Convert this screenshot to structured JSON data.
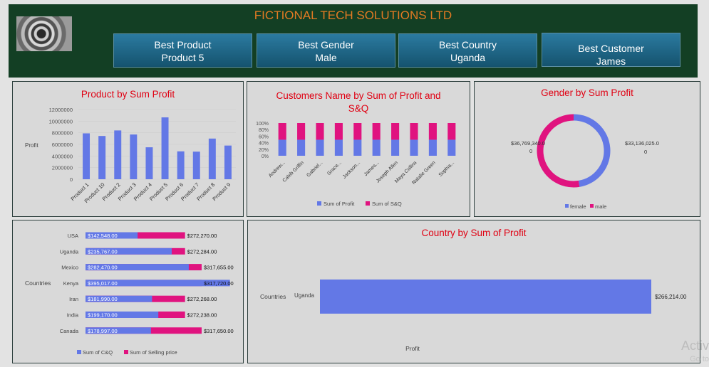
{
  "header": {
    "title": "FICTIONAL TECH SOLUTIONS LTD",
    "kpis": [
      {
        "label": "Best Product",
        "value": "Product 5"
      },
      {
        "label": "Best Gender",
        "value": "Male"
      },
      {
        "label": "Best Country",
        "value": "Uganda"
      },
      {
        "label": "Best Customer",
        "value": "James"
      }
    ]
  },
  "colors": {
    "blue": "#6378e6",
    "pink": "#e0137f",
    "title_red": "#e00012",
    "header_bg": "#133f24",
    "accent_orange": "#e27a23"
  },
  "chart_data": [
    {
      "id": "product",
      "type": "bar",
      "title": "Product by Sum Profit",
      "ylabel": "Profit",
      "ylim": [
        0,
        12000000
      ],
      "yticks": [
        "12000000",
        "10000000",
        "8000000",
        "6000000",
        "4000000",
        "2000000",
        "0"
      ],
      "categories": [
        "Product 1",
        "Product 10",
        "Product 2",
        "Product 3",
        "Product 4",
        "Product 5",
        "Product 6",
        "Product 7",
        "Product 8",
        "Product 9"
      ],
      "values": [
        7900000,
        7450000,
        8400000,
        7700000,
        5500000,
        10650000,
        4800000,
        4750000,
        7000000,
        5800000
      ]
    },
    {
      "id": "customers",
      "type": "bar",
      "stacked_percent": true,
      "title": "Customers Name by Sum of Profit and S&Q",
      "yticks": [
        "100%",
        "80%",
        "60%",
        "40%",
        "20%",
        "0%"
      ],
      "categories": [
        "Andrew...",
        "Caleb Griffin",
        "Gabriel...",
        "Grace...",
        "Jackson...",
        "James...",
        "Joseph Allen",
        "Maya Collins",
        "Natalie Green",
        "Sophia..."
      ],
      "series": [
        {
          "name": "Sum of Profit",
          "values": [
            49,
            49,
            49,
            49,
            49,
            49,
            49,
            49,
            49,
            49
          ]
        },
        {
          "name": "Sum of S&Q",
          "values": [
            51,
            51,
            51,
            51,
            51,
            51,
            51,
            51,
            51,
            51
          ]
        }
      ],
      "legend": "bottom"
    },
    {
      "id": "gender",
      "type": "pie",
      "donut": true,
      "title": "Gender by Sum Profit",
      "labels": [
        "female",
        "male"
      ],
      "values": [
        33136025.0,
        36769340.0
      ],
      "data_labels": [
        "$33,136,025.0\n0",
        "$36,769,340.0\n0"
      ],
      "legend": "bottom"
    },
    {
      "id": "countries",
      "type": "bar",
      "orientation": "horizontal",
      "ylabel": "Countries",
      "categories": [
        "USA",
        "Uganda",
        "Mexico",
        "Kenya",
        "Iran",
        "India",
        "Canada"
      ],
      "series": [
        {
          "name": "Sum of C&Q",
          "values": [
            142548,
            235767,
            282470,
            395017,
            181990,
            199170,
            178997
          ],
          "labels": [
            "$142,548.00",
            "$235,767.00",
            "$282,470.00",
            "$395,017.00",
            "$181,990.00",
            "$199,170.00",
            "$178,997.00"
          ]
        },
        {
          "name": "Sum of Selling price",
          "values": [
            272270,
            272284,
            317655,
            317720,
            272268,
            272238,
            317650
          ],
          "labels": [
            "$272,270.00",
            "$272,284.00",
            "$317,655.00",
            "$317,720.00",
            "$272,268.00",
            "$272,238.00",
            "$317,650.00"
          ]
        }
      ],
      "legend": "bottom"
    },
    {
      "id": "country_profit",
      "type": "bar",
      "orientation": "horizontal",
      "title": "Country by Sum of Profit",
      "ylabel": "Countries",
      "xlabel": "Profit",
      "categories": [
        "Uganda"
      ],
      "values": [
        266214
      ],
      "labels": [
        "$266,214.00"
      ]
    }
  ],
  "watermark": {
    "line1": "Activ",
    "line2": "Go to"
  }
}
